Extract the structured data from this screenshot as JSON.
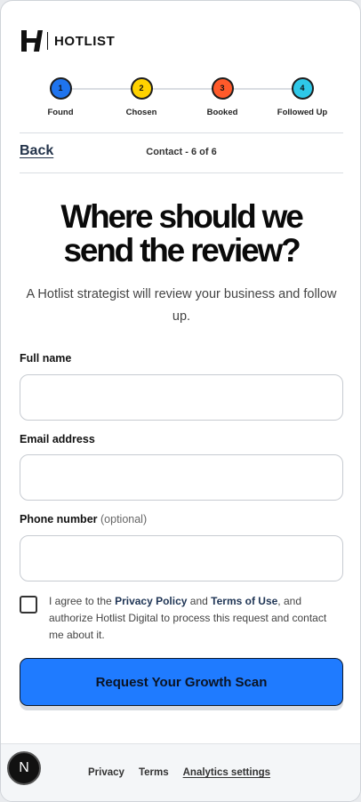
{
  "brand": {
    "name": "HOTLIST"
  },
  "steps": [
    {
      "number": "1",
      "label": "Found",
      "color": "#1f74ee"
    },
    {
      "number": "2",
      "label": "Chosen",
      "color": "#ffd200"
    },
    {
      "number": "3",
      "label": "Booked",
      "color": "#ff5a2a"
    },
    {
      "number": "4",
      "label": "Followed Up",
      "color": "#2ec8e8"
    }
  ],
  "nav": {
    "back_label": "Back",
    "progress_text": "Contact - 6 of 6"
  },
  "headline": {
    "line1": "Where should we",
    "line2": "send the review?"
  },
  "subtext": "A Hotlist strategist will review your business and follow up.",
  "form": {
    "full_name": {
      "label": "Full name",
      "value": ""
    },
    "email": {
      "label": "Email address",
      "value": ""
    },
    "phone": {
      "label": "Phone number",
      "optional": "(optional)",
      "value": ""
    }
  },
  "consent": {
    "prefix": "I agree to the ",
    "privacy_policy": "Privacy Policy",
    "and": " and ",
    "terms_of_use": "Terms of Use",
    "suffix": ", and authorize Hotlist Digital to process this request and contact me about it.",
    "checked": false
  },
  "cta": {
    "label": "Request Your Growth Scan",
    "color": "#1f7bff"
  },
  "footer": {
    "badge": "N",
    "privacy": "Privacy",
    "terms": "Terms",
    "analytics": "Analytics settings"
  }
}
